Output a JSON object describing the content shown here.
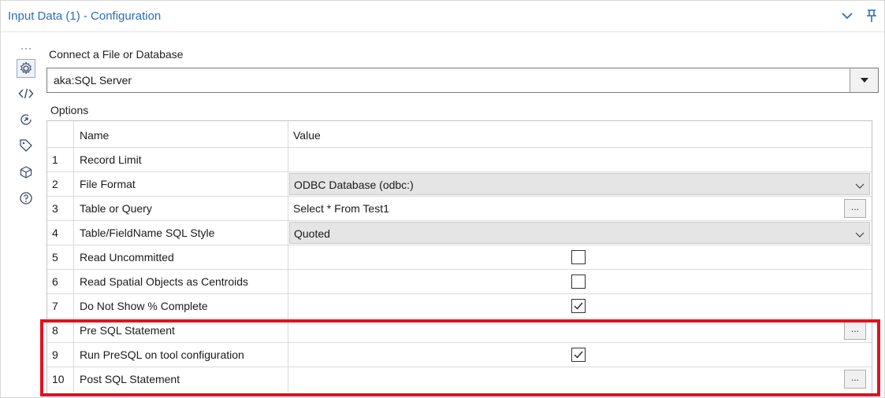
{
  "window": {
    "title": "Input Data (1) - Configuration",
    "collapse_icon": "chevron-down-icon",
    "pin_icon": "pin-icon"
  },
  "sidebar": {
    "items": [
      {
        "icon": "gear-icon",
        "active": true
      },
      {
        "icon": "code-icon",
        "active": false
      },
      {
        "icon": "circular-arrow-icon",
        "active": false
      },
      {
        "icon": "tag-icon",
        "active": false
      },
      {
        "icon": "cube-icon",
        "active": false
      },
      {
        "icon": "help-icon",
        "active": false
      }
    ]
  },
  "connection": {
    "label": "Connect a File or Database",
    "value": "aka:SQL Server"
  },
  "options": {
    "label": "Options",
    "columns": {
      "name": "Name",
      "value": "Value"
    },
    "rows": [
      {
        "num": "1",
        "name": "Record Limit",
        "type": "text",
        "value": ""
      },
      {
        "num": "2",
        "name": "File Format",
        "type": "dropdown",
        "value": "ODBC Database (odbc:)"
      },
      {
        "num": "3",
        "name": "Table or Query",
        "type": "text-ellipsis",
        "value": "Select * From Test1"
      },
      {
        "num": "4",
        "name": "Table/FieldName SQL Style",
        "type": "dropdown",
        "value": "Quoted"
      },
      {
        "num": "5",
        "name": "Read Uncommitted",
        "type": "checkbox",
        "checked": false
      },
      {
        "num": "6",
        "name": "Read Spatial Objects as Centroids",
        "type": "checkbox",
        "checked": false
      },
      {
        "num": "7",
        "name": "Do Not Show % Complete",
        "type": "checkbox",
        "checked": true
      },
      {
        "num": "8",
        "name": "Pre SQL Statement",
        "type": "text-ellipsis",
        "value": ""
      },
      {
        "num": "9",
        "name": "Run PreSQL on tool configuration",
        "type": "checkbox",
        "checked": true
      },
      {
        "num": "10",
        "name": "Post SQL Statement",
        "type": "text-ellipsis",
        "value": ""
      }
    ],
    "ellipsis_label": "..."
  },
  "colors": {
    "title": "#2a6cc0",
    "highlight": "#e3111e"
  }
}
